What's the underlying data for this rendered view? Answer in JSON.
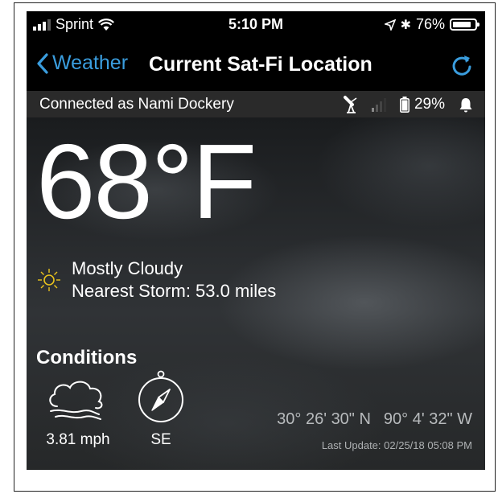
{
  "status_bar": {
    "carrier": "Sprint",
    "time": "5:10 PM",
    "battery_percent": "76%"
  },
  "nav": {
    "back_label": "Weather",
    "title": "Current Sat-Fi Location"
  },
  "connection": {
    "text": "Connected as Nami Dockery",
    "device_battery": "29%"
  },
  "weather": {
    "temperature": "68°F",
    "condition": "Mostly Cloudy",
    "nearest_storm": "Nearest Storm: 53.0 miles",
    "conditions_heading": "Conditions",
    "wind_speed": "3.81 mph",
    "wind_direction": "SE",
    "latitude": "30° 26' 30\" N",
    "longitude": "90° 4' 32\" W",
    "last_update": "Last Update: 02/25/18 05:08 PM"
  },
  "colors": {
    "accent_blue": "#3a9dde",
    "sun_yellow": "#e8c21d",
    "background": "#000000"
  },
  "icons": [
    "wifi-icon",
    "location-arrow-icon",
    "bluetooth-icon",
    "refresh-icon",
    "satellite-icon",
    "signal-icon",
    "battery-icon",
    "bell-icon",
    "sun-icon",
    "wind-cloud-icon",
    "compass-icon"
  ]
}
